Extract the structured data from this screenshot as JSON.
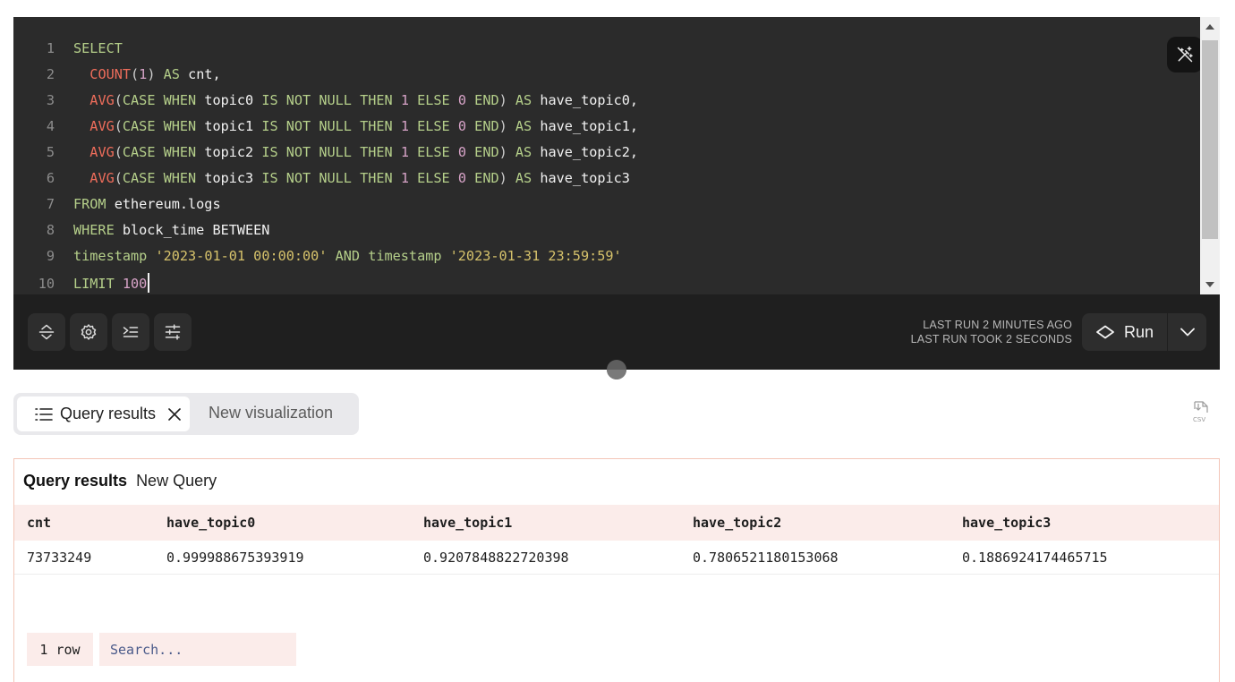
{
  "editor": {
    "lines": [
      {
        "n": "1",
        "tokens": [
          {
            "t": "SELECT",
            "c": "kw"
          }
        ]
      },
      {
        "n": "2",
        "tokens": [
          {
            "t": "  ",
            "c": "op"
          },
          {
            "t": "COUNT",
            "c": "fn"
          },
          {
            "t": "(",
            "c": "op"
          },
          {
            "t": "1",
            "c": "num"
          },
          {
            "t": ") ",
            "c": "op"
          },
          {
            "t": "AS",
            "c": "kw"
          },
          {
            "t": " cnt,",
            "c": "id"
          }
        ]
      },
      {
        "n": "3",
        "tokens": [
          {
            "t": "  ",
            "c": "op"
          },
          {
            "t": "AVG",
            "c": "fn"
          },
          {
            "t": "(",
            "c": "op"
          },
          {
            "t": "CASE WHEN",
            "c": "kw"
          },
          {
            "t": " topic0 ",
            "c": "id"
          },
          {
            "t": "IS NOT NULL THEN",
            "c": "kw"
          },
          {
            "t": " ",
            "c": "op"
          },
          {
            "t": "1",
            "c": "num"
          },
          {
            "t": " ",
            "c": "op"
          },
          {
            "t": "ELSE",
            "c": "kw"
          },
          {
            "t": " ",
            "c": "op"
          },
          {
            "t": "0",
            "c": "num"
          },
          {
            "t": " ",
            "c": "op"
          },
          {
            "t": "END",
            "c": "kw"
          },
          {
            "t": ") ",
            "c": "op"
          },
          {
            "t": "AS",
            "c": "kw"
          },
          {
            "t": " have_topic0,",
            "c": "id"
          }
        ]
      },
      {
        "n": "4",
        "tokens": [
          {
            "t": "  ",
            "c": "op"
          },
          {
            "t": "AVG",
            "c": "fn"
          },
          {
            "t": "(",
            "c": "op"
          },
          {
            "t": "CASE WHEN",
            "c": "kw"
          },
          {
            "t": " topic1 ",
            "c": "id"
          },
          {
            "t": "IS NOT NULL THEN",
            "c": "kw"
          },
          {
            "t": " ",
            "c": "op"
          },
          {
            "t": "1",
            "c": "num"
          },
          {
            "t": " ",
            "c": "op"
          },
          {
            "t": "ELSE",
            "c": "kw"
          },
          {
            "t": " ",
            "c": "op"
          },
          {
            "t": "0",
            "c": "num"
          },
          {
            "t": " ",
            "c": "op"
          },
          {
            "t": "END",
            "c": "kw"
          },
          {
            "t": ") ",
            "c": "op"
          },
          {
            "t": "AS",
            "c": "kw"
          },
          {
            "t": " have_topic1,",
            "c": "id"
          }
        ]
      },
      {
        "n": "5",
        "tokens": [
          {
            "t": "  ",
            "c": "op"
          },
          {
            "t": "AVG",
            "c": "fn"
          },
          {
            "t": "(",
            "c": "op"
          },
          {
            "t": "CASE WHEN",
            "c": "kw"
          },
          {
            "t": " topic2 ",
            "c": "id"
          },
          {
            "t": "IS NOT NULL THEN",
            "c": "kw"
          },
          {
            "t": " ",
            "c": "op"
          },
          {
            "t": "1",
            "c": "num"
          },
          {
            "t": " ",
            "c": "op"
          },
          {
            "t": "ELSE",
            "c": "kw"
          },
          {
            "t": " ",
            "c": "op"
          },
          {
            "t": "0",
            "c": "num"
          },
          {
            "t": " ",
            "c": "op"
          },
          {
            "t": "END",
            "c": "kw"
          },
          {
            "t": ") ",
            "c": "op"
          },
          {
            "t": "AS",
            "c": "kw"
          },
          {
            "t": " have_topic2,",
            "c": "id"
          }
        ]
      },
      {
        "n": "6",
        "tokens": [
          {
            "t": "  ",
            "c": "op"
          },
          {
            "t": "AVG",
            "c": "fn"
          },
          {
            "t": "(",
            "c": "op"
          },
          {
            "t": "CASE WHEN",
            "c": "kw"
          },
          {
            "t": " topic3 ",
            "c": "id"
          },
          {
            "t": "IS NOT NULL THEN",
            "c": "kw"
          },
          {
            "t": " ",
            "c": "op"
          },
          {
            "t": "1",
            "c": "num"
          },
          {
            "t": " ",
            "c": "op"
          },
          {
            "t": "ELSE",
            "c": "kw"
          },
          {
            "t": " ",
            "c": "op"
          },
          {
            "t": "0",
            "c": "num"
          },
          {
            "t": " ",
            "c": "op"
          },
          {
            "t": "END",
            "c": "kw"
          },
          {
            "t": ") ",
            "c": "op"
          },
          {
            "t": "AS",
            "c": "kw"
          },
          {
            "t": " have_topic3",
            "c": "id"
          }
        ]
      },
      {
        "n": "7",
        "tokens": [
          {
            "t": "FROM",
            "c": "kw"
          },
          {
            "t": " ethereum.logs",
            "c": "id"
          }
        ]
      },
      {
        "n": "8",
        "tokens": [
          {
            "t": "WHERE",
            "c": "kw"
          },
          {
            "t": " block_time BETWEEN",
            "c": "id"
          }
        ]
      },
      {
        "n": "9",
        "tokens": [
          {
            "t": "timestamp",
            "c": "kw"
          },
          {
            "t": " ",
            "c": "op"
          },
          {
            "t": "'2023-01-01 00:00:00'",
            "c": "str"
          },
          {
            "t": " AND timestamp ",
            "c": "kw"
          },
          {
            "t": "'2023-01-31 23:59:59'",
            "c": "str"
          }
        ]
      },
      {
        "n": "10",
        "tokens": [
          {
            "t": "LIMIT",
            "c": "kw"
          },
          {
            "t": " ",
            "c": "op"
          },
          {
            "t": "100",
            "c": "num"
          }
        ],
        "caret": true
      }
    ]
  },
  "toolbar": {
    "last_run": "LAST RUN 2 MINUTES AGO",
    "last_run_took": "LAST RUN TOOK 2 SECONDS",
    "run_label": "Run"
  },
  "tabs": {
    "query_results": "Query results",
    "new_visualization": "New visualization"
  },
  "results": {
    "title": "Query results",
    "query_name": "New Query",
    "columns": [
      "cnt",
      "have_topic0",
      "have_topic1",
      "have_topic2",
      "have_topic3"
    ],
    "rows": [
      [
        "73733249",
        "0.999988675393919",
        "0.9207848822720398",
        "0.7806521180153068",
        "0.1886924174465715"
      ]
    ],
    "row_count": "1 row",
    "search_placeholder": "Search..."
  },
  "colors": {
    "editor_bg": "#2b2b2b",
    "toolbar_bg": "#1f1f1f",
    "header_row_bg": "#fbecea",
    "panel_border": "#f3c6b8"
  }
}
